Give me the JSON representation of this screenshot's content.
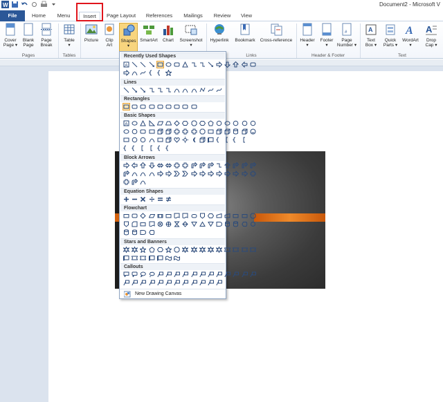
{
  "window": {
    "title": "Document2 - Microsoft V"
  },
  "qat": {
    "icons": [
      "word-logo-icon",
      "save-icon",
      "undo-icon",
      "redo-icon",
      "print-icon",
      "customize-qat-icon"
    ]
  },
  "tabs": [
    "File",
    "Home",
    "Menu",
    "Insert",
    "Page Layout",
    "References",
    "Mailings",
    "Review",
    "View"
  ],
  "ribbon": {
    "cover_page": "Cover\nPage ▾",
    "blank_page": "Blank\nPage",
    "page_break": "Page\nBreak",
    "group_pages": "Pages",
    "table": "Table\n▾",
    "group_tables": "Tables",
    "picture": "Picture",
    "clip_art": "Clip\nArt",
    "shapes": "Shapes\n▾",
    "smartart": "SmartArt",
    "chart": "Chart",
    "screenshot": "Screenshot\n▾",
    "hyperlink": "Hyperlink",
    "bookmark": "Bookmark",
    "cross_reference": "Cross-reference",
    "group_links": "Links",
    "header": "Header\n▾",
    "footer": "Footer\n▾",
    "page_number": "Page\nNumber ▾",
    "group_header_footer": "Header & Footer",
    "text_box": "Text\nBox ▾",
    "quick_parts": "Quick\nParts ▾",
    "wordart": "WordArt\n▾",
    "drop_cap": "Drop\nCap ▾",
    "group_text": "Text"
  },
  "shapes_menu": {
    "sections": [
      "Recently Used Shapes",
      "Lines",
      "Rectangles",
      "Basic Shapes",
      "Block Arrows",
      "Equation Shapes",
      "Flowchart",
      "Stars and Banners",
      "Callouts"
    ],
    "new_drawing_canvas": "New Drawing Canvas"
  },
  "colors": {
    "file_tab": "#2b5797",
    "highlight": "#e0141b",
    "orange_bar": "#e87a1d"
  }
}
